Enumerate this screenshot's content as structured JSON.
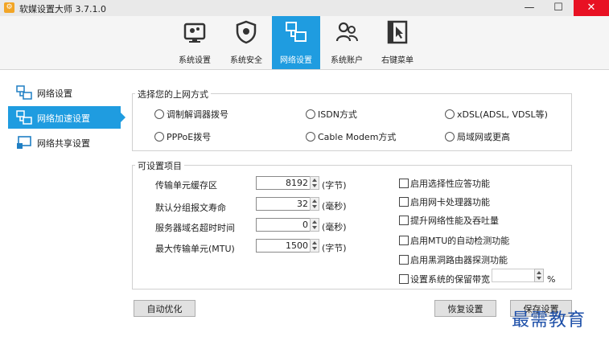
{
  "window": {
    "title": "软媒设置大师 3.7.1.0",
    "minimize": "—",
    "maximize": "☐",
    "close": "✕"
  },
  "toolbar": {
    "items": [
      {
        "label": "系统设置",
        "icon": "settings-icon"
      },
      {
        "label": "系统安全",
        "icon": "shield-icon"
      },
      {
        "label": "网络设置",
        "icon": "network-icon",
        "active": true
      },
      {
        "label": "系统账户",
        "icon": "users-icon"
      },
      {
        "label": "右键菜单",
        "icon": "cursor-menu-icon"
      }
    ]
  },
  "sidebar": {
    "items": [
      {
        "label": "网络设置",
        "icon": "network-settings-icon"
      },
      {
        "label": "网络加速设置",
        "icon": "network-accelerate-icon",
        "active": true
      },
      {
        "label": "网络共享设置",
        "icon": "network-share-icon"
      }
    ]
  },
  "connection": {
    "legend": "选择您的上网方式",
    "options": [
      "调制解调器拨号",
      "ISDN方式",
      "xDSL(ADSL, VDSL等)",
      "PPPoE拨号",
      "Cable Modem方式",
      "局域网或更高"
    ]
  },
  "params": {
    "legend": "可设置项目",
    "fields": [
      {
        "label": "传输单元缓存区",
        "value": "8192",
        "unit": "(字节)"
      },
      {
        "label": "默认分组报文寿命",
        "value": "32",
        "unit": "(毫秒)"
      },
      {
        "label": "服务器域名超时时间",
        "value": "0",
        "unit": "(毫秒)"
      },
      {
        "label": "最大传输单元(MTU)",
        "value": "1500",
        "unit": "(字节)"
      }
    ],
    "checks": [
      "启用选择性应答功能",
      "启用网卡处理器功能",
      "提升网络性能及吞吐量",
      "启用MTU的自动检测功能",
      "启用黑洞路由器探测功能",
      "设置系统的保留带宽"
    ],
    "bandwidth_value": "",
    "bandwidth_unit": "%"
  },
  "buttons": {
    "auto": "自动优化",
    "restore": "恢复设置",
    "save": "保存设置"
  },
  "watermark": "最需教育",
  "colors": {
    "accent": "#1f9ce0",
    "close": "#e81123",
    "watermark": "#1d4fa8"
  }
}
